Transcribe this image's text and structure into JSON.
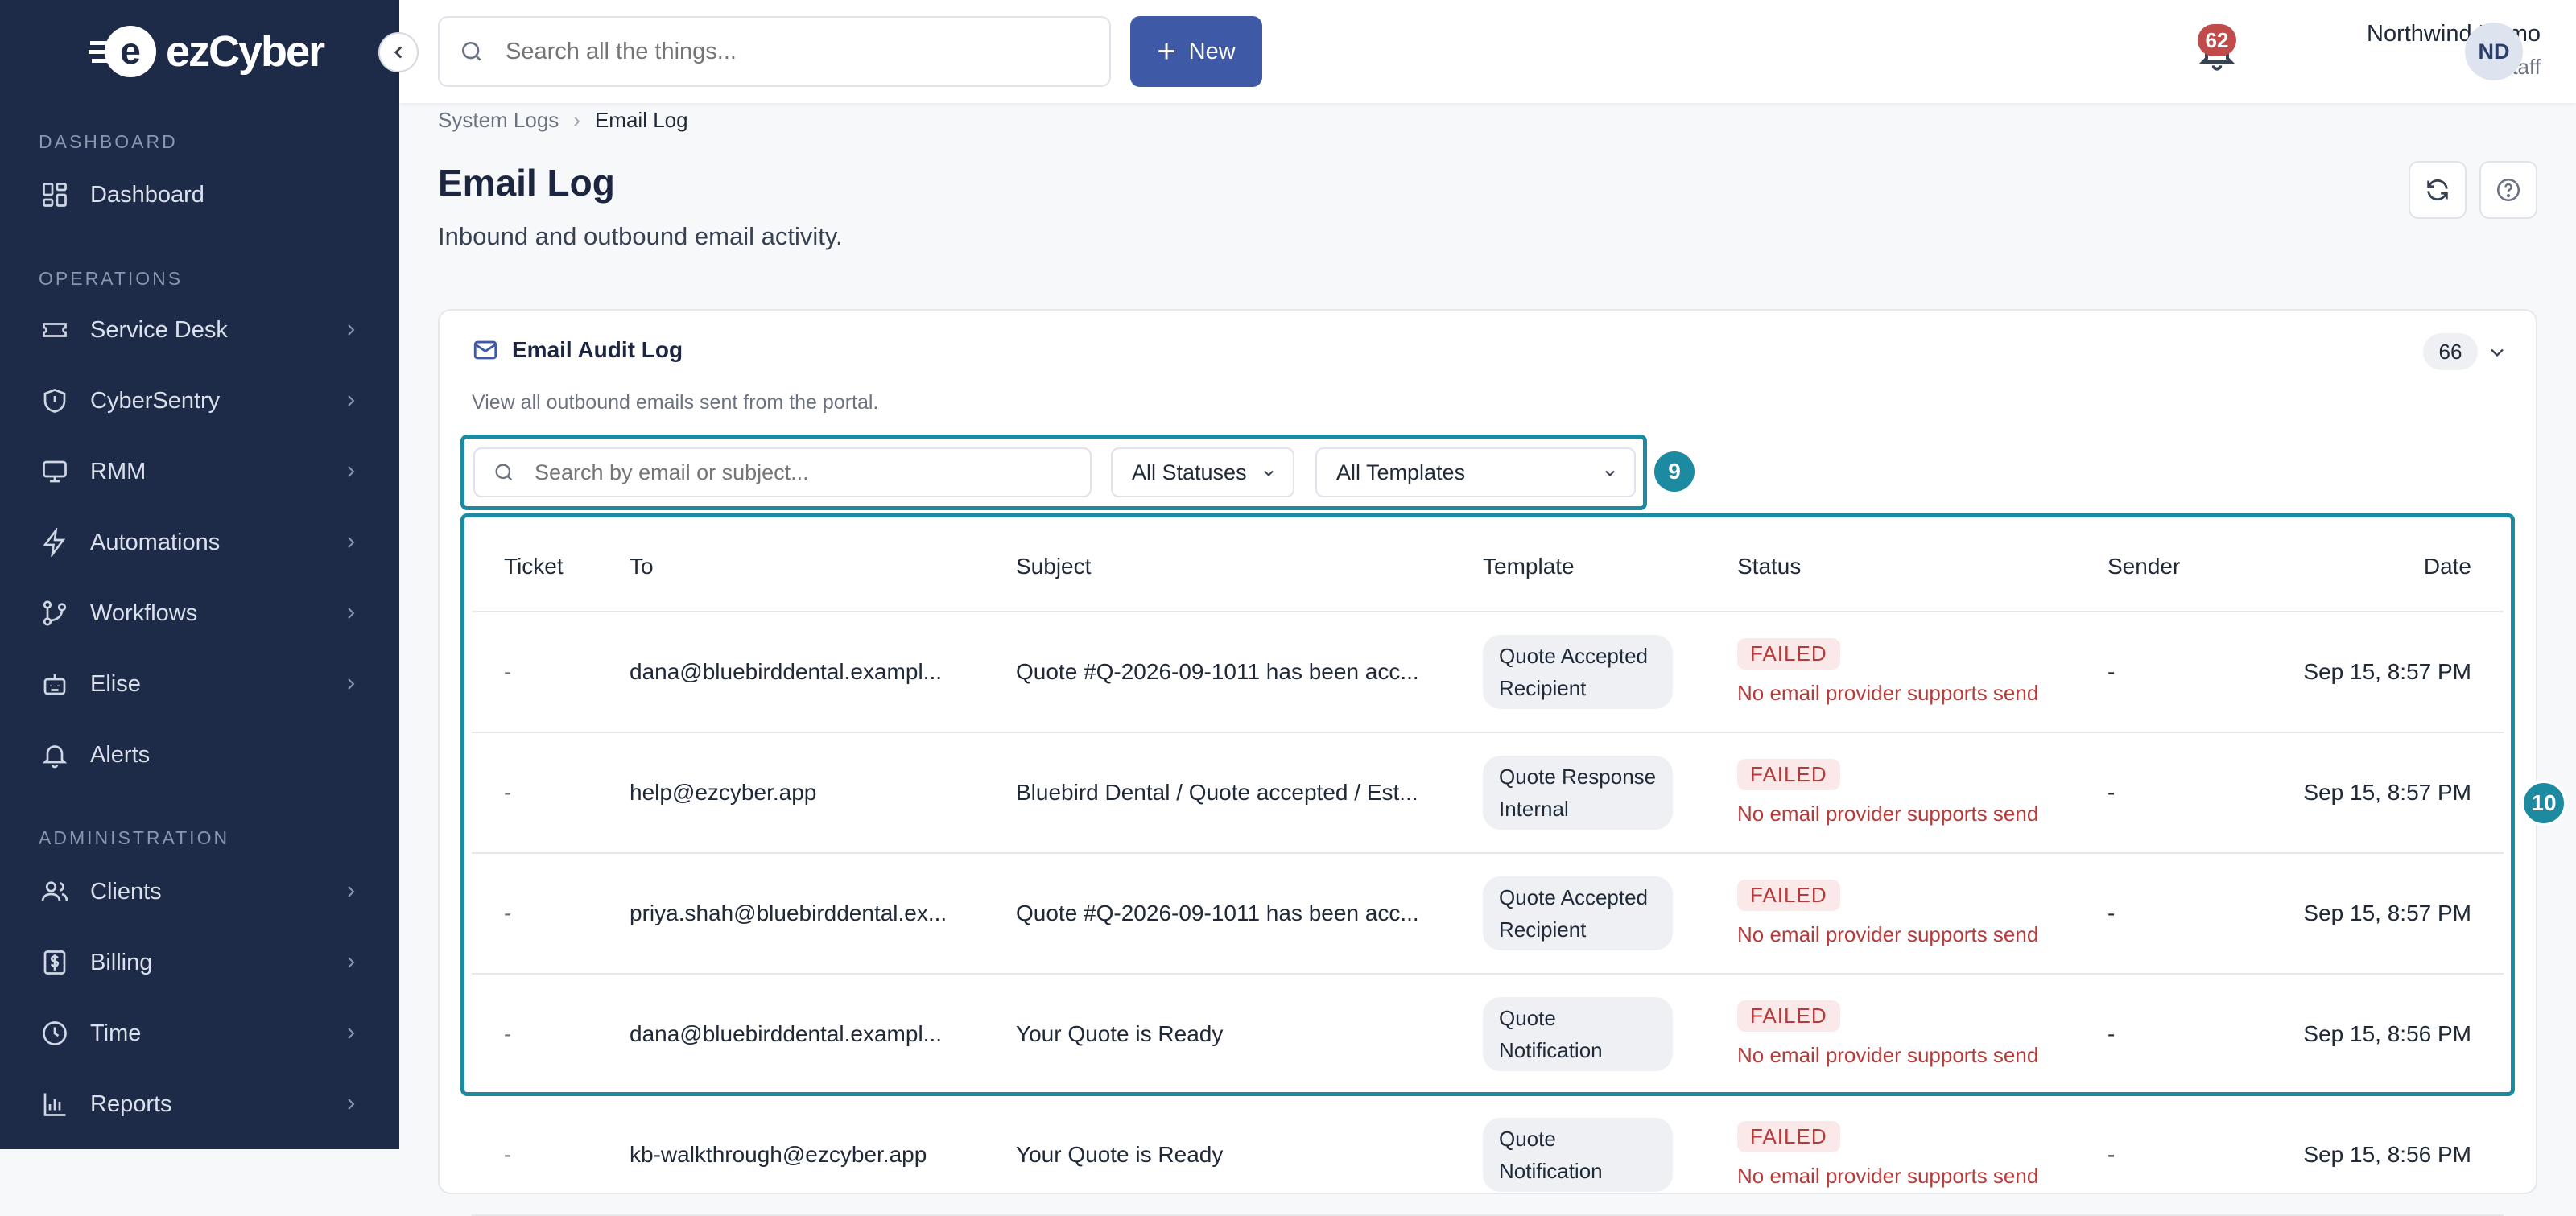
{
  "brand": {
    "name": "ezCyber",
    "mark": "e"
  },
  "sidebar": {
    "sections": [
      {
        "label": "DASHBOARD",
        "items": [
          {
            "label": "Dashboard",
            "icon": "dashboard-icon"
          }
        ]
      },
      {
        "label": "OPERATIONS",
        "items": [
          {
            "label": "Service Desk",
            "icon": "ticket-icon"
          },
          {
            "label": "CyberSentry",
            "icon": "shield-icon"
          },
          {
            "label": "RMM",
            "icon": "monitor-icon"
          },
          {
            "label": "Automations",
            "icon": "lightning-icon"
          },
          {
            "label": "Workflows",
            "icon": "workflow-icon"
          },
          {
            "label": "Elise",
            "icon": "robot-icon"
          },
          {
            "label": "Alerts",
            "icon": "bell-icon"
          }
        ]
      },
      {
        "label": "ADMINISTRATION",
        "items": [
          {
            "label": "Clients",
            "icon": "users-icon"
          },
          {
            "label": "Billing",
            "icon": "dollar-icon"
          },
          {
            "label": "Time",
            "icon": "clock-icon"
          },
          {
            "label": "Reports",
            "icon": "chart-icon"
          }
        ]
      }
    ]
  },
  "topbar": {
    "search_placeholder": "Search all the things...",
    "new_label": "New",
    "notifications_count": "62",
    "user_name": "Northwind Demo",
    "user_role": "Staff",
    "user_initials": "ND"
  },
  "breadcrumb": {
    "parent": "System Logs",
    "current": "Email Log"
  },
  "page": {
    "title": "Email Log",
    "subtitle": "Inbound and outbound email activity."
  },
  "card": {
    "title": "Email Audit Log",
    "description": "View all outbound emails sent from the portal.",
    "count": "66",
    "filters": {
      "search_placeholder": "Search by email or subject...",
      "status_value": "All Statuses",
      "template_value": "All Templates"
    },
    "annotations": {
      "filters": "9",
      "table": "10"
    },
    "columns": [
      "Ticket",
      "To",
      "Subject",
      "Template",
      "Status",
      "Sender",
      "Date"
    ],
    "rows": [
      {
        "ticket": "-",
        "to": "dana@bluebirddental.exampl...",
        "subject": "Quote #Q-2026-09-1011 has been acc...",
        "template": "Quote Accepted Recipient",
        "status": "FAILED",
        "error": "No email provider supports send",
        "sender": "-",
        "date": "Sep 15, 8:57 PM"
      },
      {
        "ticket": "-",
        "to": "help@ezcyber.app",
        "subject": "Bluebird Dental / Quote accepted / Est...",
        "template": "Quote Response Internal",
        "status": "FAILED",
        "error": "No email provider supports send",
        "sender": "-",
        "date": "Sep 15, 8:57 PM"
      },
      {
        "ticket": "-",
        "to": "priya.shah@bluebirddental.ex...",
        "subject": "Quote #Q-2026-09-1011 has been acc...",
        "template": "Quote Accepted Recipient",
        "status": "FAILED",
        "error": "No email provider supports send",
        "sender": "-",
        "date": "Sep 15, 8:57 PM"
      },
      {
        "ticket": "-",
        "to": "dana@bluebirddental.exampl...",
        "subject": "Your Quote is Ready",
        "template": "Quote Notification",
        "status": "FAILED",
        "error": "No email provider supports send",
        "sender": "-",
        "date": "Sep 15, 8:56 PM"
      },
      {
        "ticket": "-",
        "to": "kb-walkthrough@ezcyber.app",
        "subject": "Your Quote is Ready",
        "template": "Quote Notification",
        "status": "FAILED",
        "error": "No email provider supports send",
        "sender": "-",
        "date": "Sep 15, 8:56 PM"
      }
    ]
  },
  "colors": {
    "sidebar_bg": "#1d2b48",
    "accent": "#3e5aa6",
    "highlight": "#1c8aa0",
    "failed": "#b53b3b"
  }
}
